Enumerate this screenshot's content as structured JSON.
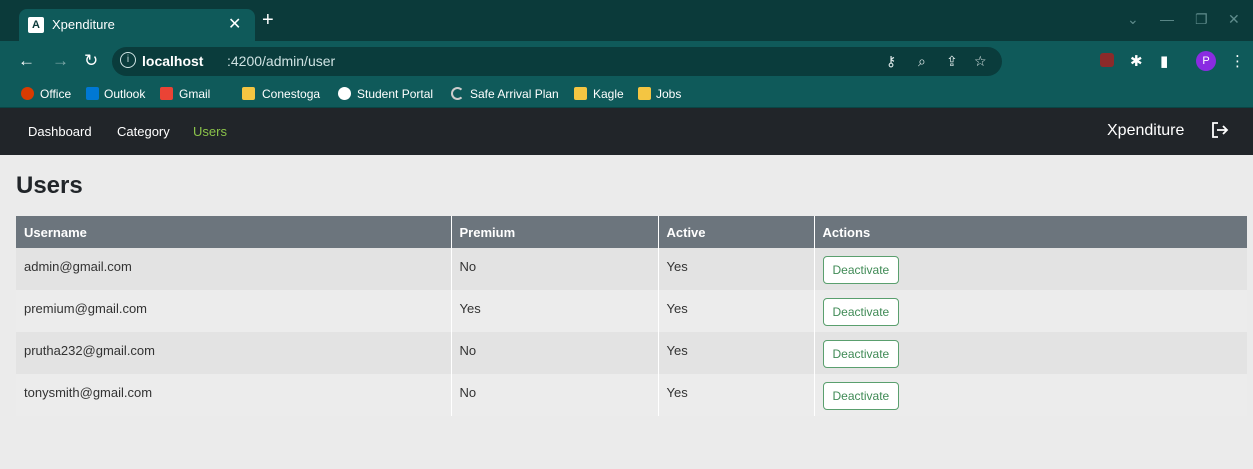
{
  "browser": {
    "tab_title": "Xpenditure",
    "tab_favicon": "A",
    "url_host": "localhost",
    "url_path": ":4200/admin/user",
    "profile_initial": "P",
    "bookmarks": [
      {
        "label": "Office",
        "icon": "office-icon",
        "color": "#d83b01"
      },
      {
        "label": "Outlook",
        "icon": "outlook-icon",
        "color": "#0078d4"
      },
      {
        "label": "Gmail",
        "icon": "gmail-icon",
        "color": "#ea4335"
      },
      {
        "label": "Conestoga",
        "icon": "folder-icon",
        "color": "#f4c542"
      },
      {
        "label": "Student Portal",
        "icon": "globe-icon",
        "color": "#ffffff"
      },
      {
        "label": "Safe Arrival Plan",
        "icon": "loading-icon",
        "color": "#cccccc"
      },
      {
        "label": "Kagle",
        "icon": "folder-icon",
        "color": "#f4c542"
      },
      {
        "label": "Jobs",
        "icon": "folder-icon",
        "color": "#f4c542"
      }
    ]
  },
  "nav": {
    "links": [
      "Dashboard",
      "Category",
      "Users"
    ],
    "active": "Users",
    "brand": "Xpenditure"
  },
  "page": {
    "title": "Users",
    "columns": [
      "Username",
      "Premium",
      "Active",
      "Actions"
    ],
    "rows": [
      {
        "username": "admin@gmail.com",
        "premium": "No",
        "active": "Yes",
        "action": "Deactivate"
      },
      {
        "username": "premium@gmail.com",
        "premium": "Yes",
        "active": "Yes",
        "action": "Deactivate"
      },
      {
        "username": "prutha232@gmail.com",
        "premium": "No",
        "active": "Yes",
        "action": "Deactivate"
      },
      {
        "username": "tonysmith@gmail.com",
        "premium": "No",
        "active": "Yes",
        "action": "Deactivate"
      }
    ]
  },
  "colors": {
    "tabstrip": "#0b3a3a",
    "toolbar": "#0f5a5a",
    "appnav": "#212529",
    "active_link": "#8bc34a",
    "table_header": "#6c757d",
    "button_outline": "#5a9f6e"
  }
}
